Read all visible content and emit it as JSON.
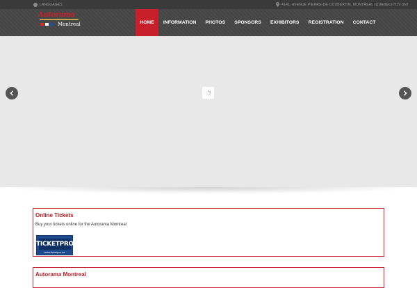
{
  "topbar": {
    "language_label": "LANGUAGES",
    "address": "4141, AVENUE PIERRE-DE COUBERTIN, MONTREAL (QUEBEC) H1V 3N7",
    "icons": [
      "globe-icon",
      "map-pin-icon"
    ]
  },
  "logo": {
    "brand": "Autorama",
    "city": "Montreal"
  },
  "nav": {
    "items": [
      {
        "label": "HOME",
        "active": true
      },
      {
        "label": "INFORMATION",
        "active": false
      },
      {
        "label": "PHOTOS",
        "active": false
      },
      {
        "label": "SPONSORS",
        "active": false
      },
      {
        "label": "EXHIBITORS",
        "active": false
      },
      {
        "label": "REGISTRATION",
        "active": false
      },
      {
        "label": "CONTACT",
        "active": false
      }
    ],
    "active_color": "#c8202a"
  },
  "slider": {
    "icons": [
      "chevron-left-icon",
      "loading-spinner-icon",
      "chevron-right-icon"
    ]
  },
  "online_tickets": {
    "title": "Online Tickets",
    "text": "Buy your tickets online for the Autorama Montreal",
    "logo_text": "TICKETPRO",
    "logo_url": "www.ticketpro.ca"
  },
  "autorama_box": {
    "title": "Autorama Montreal"
  },
  "colors": {
    "accent": "#c8202a",
    "topbar": "#3a3a3a",
    "header": "#4a4a4a",
    "slider_bg": "#e8e8e8"
  }
}
